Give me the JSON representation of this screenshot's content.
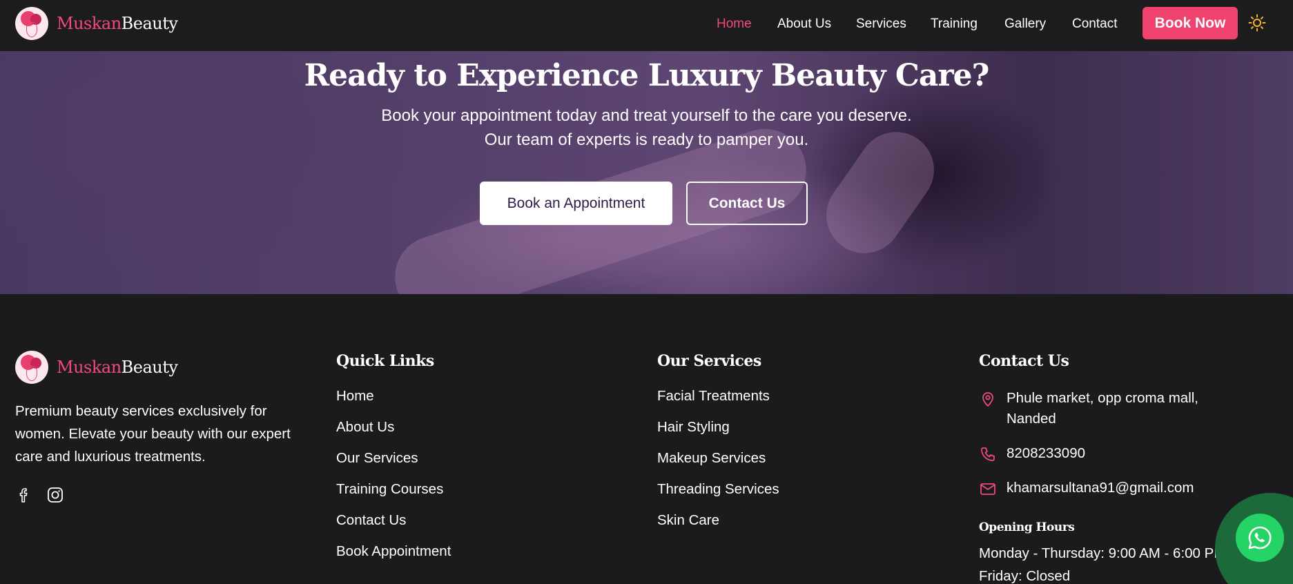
{
  "brand": {
    "name_part1": "Muskan",
    "name_part2": "Beauty"
  },
  "nav": {
    "items": [
      {
        "label": "Home",
        "active": true
      },
      {
        "label": "About Us"
      },
      {
        "label": "Services"
      },
      {
        "label": "Training"
      },
      {
        "label": "Gallery"
      },
      {
        "label": "Contact"
      }
    ],
    "cta": "Book Now",
    "theme_toggle_icon": "sun-icon"
  },
  "hero": {
    "title": "Ready to Experience Luxury Beauty Care?",
    "subtitle_line1": "Book your appointment today and treat yourself to the care you deserve.",
    "subtitle_line2": "Our team of experts is ready to pamper you.",
    "primary_button": "Book an Appointment",
    "secondary_button": "Contact Us"
  },
  "footer": {
    "description": "Premium beauty services exclusively for women. Elevate your beauty with our expert care and luxurious treatments.",
    "social_icons": [
      "facebook-icon",
      "instagram-icon"
    ],
    "quick_links": {
      "title": "Quick Links",
      "items": [
        "Home",
        "About Us",
        "Our Services",
        "Training Courses",
        "Contact Us",
        "Book Appointment"
      ]
    },
    "services": {
      "title": "Our Services",
      "items": [
        "Facial Treatments",
        "Hair Styling",
        "Makeup Services",
        "Threading Services",
        "Skin Care"
      ]
    },
    "contact": {
      "title": "Contact Us",
      "address_line1": "Phule market, opp croma mall,",
      "address_line2": "Nanded",
      "phone": "8208233090",
      "email": "khamarsultana91@gmail.com",
      "hours_title": "Opening Hours",
      "hours": [
        "Monday - Thursday: 9:00 AM - 6:00 PM",
        "Friday: Closed"
      ]
    }
  },
  "colors": {
    "accent": "#f0426f",
    "background": "#1b1a1c",
    "whatsapp": "#25d366"
  }
}
